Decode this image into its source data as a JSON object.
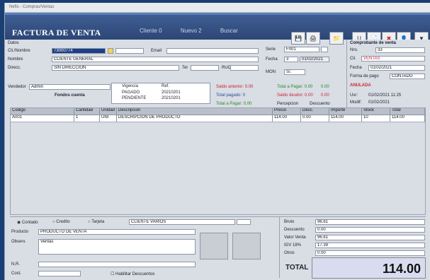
{
  "window": {
    "title": "Nefis - Compras/Ventas"
  },
  "header": {
    "title": "FACTURA DE VENTA",
    "tabs": [
      "Cliente 0",
      "Nuevo 2",
      "Buscar"
    ]
  },
  "toolbar": [
    "save",
    "print",
    "folder",
    "user",
    "doc",
    "delete",
    "person",
    "bookmark"
  ],
  "customer": {
    "id_label": "Cli./Nombre",
    "id_value": "73000774",
    "combo_value": "",
    "email_label": "Email",
    "name_label": "Nombre",
    "name_value": "CLIENTE GENERAL",
    "address_label": "Direcc.",
    "address_value": "SIN DIRECCION",
    "tel_label": "Tel",
    "ruc_label": "RUC"
  },
  "doc": {
    "serie_label": "Serie",
    "serie_value": "F001",
    "fecha_label": "Fecha",
    "fecha_value": "3",
    "date2": "01/02/2021",
    "moneda_label": "MON",
    "moneda_value": "S/."
  },
  "right_panel": {
    "title": "Comprobante de venta",
    "numero_label": "Nro.",
    "numero_value": "33",
    "cliente_label": "Cli.",
    "cliente_value": "VENTAS",
    "fecha_label": "Fecha",
    "fecha_value": "01/02/2021",
    "forma_label": "Forma de pago",
    "forma_value": "CONTADO",
    "estado_label": "ANULADA",
    "user_label": "Usr:",
    "user_value": "01/02/2021 11:25",
    "user2_label": "Modif:",
    "user2_value": "01/02/2021"
  },
  "payment": {
    "vendor_label": "Vendedor",
    "vendor_value": "Admin",
    "pay_label": "Fondos cuenta",
    "cols": [
      "Vigencia",
      "Ref."
    ],
    "rows": [
      [
        "PAGADO",
        "20210201"
      ],
      [
        "PENDIENTE",
        "20210201"
      ]
    ]
  },
  "summary": {
    "col1": [
      "Saldo anterior: 0.00",
      "Total pagado: 0",
      "Total a Pagar: 0.00"
    ],
    "col2": [
      "Total a Pagar: 0.00",
      "Saldo deudor: 0.00",
      "Percepcion"
    ],
    "col3": [
      "0.00",
      "0.00",
      "Descuento"
    ]
  },
  "grid": {
    "headers": [
      "Codigo",
      "Cantidad",
      "Unidad",
      "Descripcion",
      "Precio",
      "Desc.",
      "Importe",
      "Stock",
      "Total"
    ],
    "rows": [
      [
        "A001",
        "1",
        "UNI",
        "DESCRIPCION DE PRODUCTO",
        "114.00",
        "0.00",
        "114.00",
        "10",
        "114.00"
      ]
    ]
  },
  "bottom": {
    "radios": [
      "Contado",
      "Credito",
      "Tarjeta"
    ],
    "client_combo": "CLIENTE VARIOS",
    "product_label": "Producto",
    "product_value": "PRODUCTO DE VENTA",
    "obs_label": "Observ.",
    "obs_value": "Ventas",
    "nro_label": "N.R.",
    "cost_label": "Cost.",
    "cost_check": "Habilitar Descuentos"
  },
  "totals": {
    "rows": [
      {
        "label": "Bruto",
        "value": "96.61"
      },
      {
        "label": "Descuento",
        "value": "0.00"
      },
      {
        "label": "Valor Venta",
        "value": "96.61"
      },
      {
        "label": "IGV 18%",
        "value": "17.39"
      },
      {
        "label": "Otros",
        "value": "0.00"
      }
    ],
    "total_label": "TOTAL",
    "total_value": "114.00"
  }
}
